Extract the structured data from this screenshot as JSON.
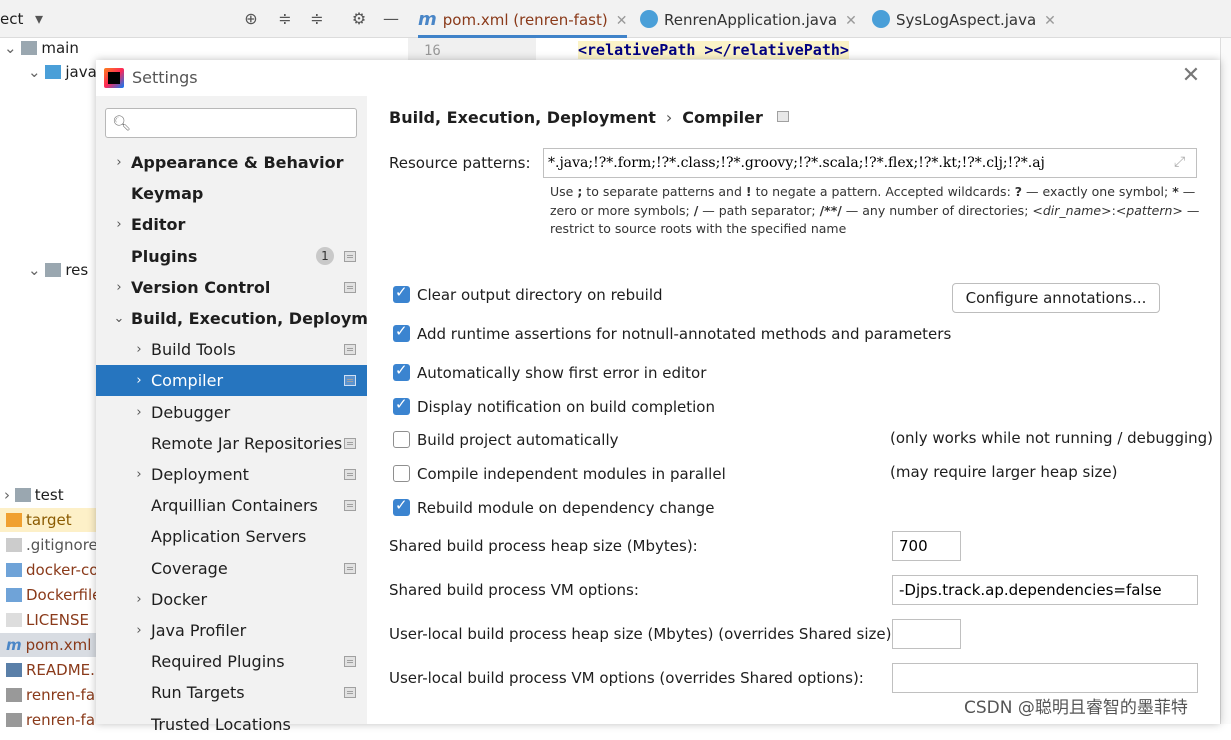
{
  "ide": {
    "project_label": "ect",
    "tabs": [
      {
        "label": "pom.xml (renren-fast)",
        "active": true
      },
      {
        "label": "RenrenApplication.java",
        "active": false
      },
      {
        "label": "SysLogAspect.java",
        "active": false
      }
    ],
    "line_number": "16",
    "code": "<relativePath ></relativePath>",
    "tree": [
      "main",
      "java",
      "res",
      "test",
      "target",
      ".gitignore",
      "docker-co",
      "Dockerfile",
      "LICENSE",
      "pom.xml",
      "README.",
      "renren-fa",
      "renren-fa"
    ]
  },
  "dialog": {
    "title": "Settings",
    "search_placeholder": "",
    "sidebar": [
      {
        "label": "Appearance & Behavior",
        "bold": true,
        "arrow": true,
        "level": 0
      },
      {
        "label": "Keymap",
        "bold": true,
        "arrow": false,
        "level": 0
      },
      {
        "label": "Editor",
        "bold": true,
        "arrow": true,
        "level": 0
      },
      {
        "label": "Plugins",
        "bold": true,
        "arrow": false,
        "level": 0,
        "badge": "1",
        "page_icon": true
      },
      {
        "label": "Version Control",
        "bold": true,
        "arrow": true,
        "level": 0,
        "page_icon": true
      },
      {
        "label": "Build, Execution, Deployment",
        "bold": true,
        "arrow": true,
        "expanded": true,
        "level": 0
      },
      {
        "label": "Build Tools",
        "arrow": true,
        "level": 1,
        "page_icon": true
      },
      {
        "label": "Compiler",
        "arrow": true,
        "level": 1,
        "page_icon": true,
        "selected": true
      },
      {
        "label": "Debugger",
        "arrow": true,
        "level": 1
      },
      {
        "label": "Remote Jar Repositories",
        "arrow": false,
        "level": 1,
        "page_icon": true
      },
      {
        "label": "Deployment",
        "arrow": true,
        "level": 1,
        "page_icon": true
      },
      {
        "label": "Arquillian Containers",
        "arrow": false,
        "level": 1,
        "page_icon": true
      },
      {
        "label": "Application Servers",
        "arrow": false,
        "level": 1
      },
      {
        "label": "Coverage",
        "arrow": false,
        "level": 1,
        "page_icon": true
      },
      {
        "label": "Docker",
        "arrow": true,
        "level": 1
      },
      {
        "label": "Java Profiler",
        "arrow": true,
        "level": 1
      },
      {
        "label": "Required Plugins",
        "arrow": false,
        "level": 1,
        "page_icon": true
      },
      {
        "label": "Run Targets",
        "arrow": false,
        "level": 1,
        "page_icon": true
      },
      {
        "label": "Trusted Locations",
        "arrow": false,
        "level": 1
      }
    ],
    "breadcrumb": {
      "parent": "Build, Execution, Deployment",
      "current": "Compiler"
    },
    "resource_patterns": {
      "label": "Resource patterns:",
      "value": "*.java;!?*.form;!?*.class;!?*.groovy;!?*.scala;!?*.flex;!?*.kt;!?*.clj;!?*.aj"
    },
    "hint": {
      "p1": "Use ",
      "b1": ";",
      "p2": " to separate patterns and ",
      "b2": "!",
      "p3": " to negate a pattern. Accepted wildcards: ",
      "b3": "?",
      "p4": " — exactly one symbol; ",
      "b4": "*",
      "p5": " — zero or more symbols; ",
      "b5": "/",
      "p6": " — path separator; ",
      "b6": "/**/",
      "p7": " — any number of directories; ",
      "i1": "<dir_name>",
      "p8": ":",
      "i2": "<pattern>",
      "p9": " — restrict to source roots with the specified name"
    },
    "options": [
      {
        "label": "Clear output directory on rebuild",
        "checked": true
      },
      {
        "label": "Add runtime assertions for notnull-annotated methods and parameters",
        "checked": true
      },
      {
        "label": "Automatically show first error in editor",
        "checked": true
      },
      {
        "label": "Display notification on build completion",
        "checked": true
      },
      {
        "label": "Build project automatically",
        "checked": false,
        "note": "(only works while not running / debugging)"
      },
      {
        "label": "Compile independent modules in parallel",
        "checked": false,
        "note": "(may require larger heap size)"
      },
      {
        "label": "Rebuild module on dependency change",
        "checked": true
      }
    ],
    "configure_button": "Configure annotations...",
    "fields": {
      "shared_heap_label": "Shared build process heap size (Mbytes):",
      "shared_heap_value": "700",
      "shared_vm_label": "Shared build process VM options:",
      "shared_vm_value": "-Djps.track.ap.dependencies=false",
      "user_heap_label": "User-local build process heap size (Mbytes) (overrides Shared size):",
      "user_heap_value": "",
      "user_vm_label": "User-local build process VM options (overrides Shared options):",
      "user_vm_value": ""
    }
  },
  "watermark": "CSDN @聪明且睿智的墨菲特"
}
